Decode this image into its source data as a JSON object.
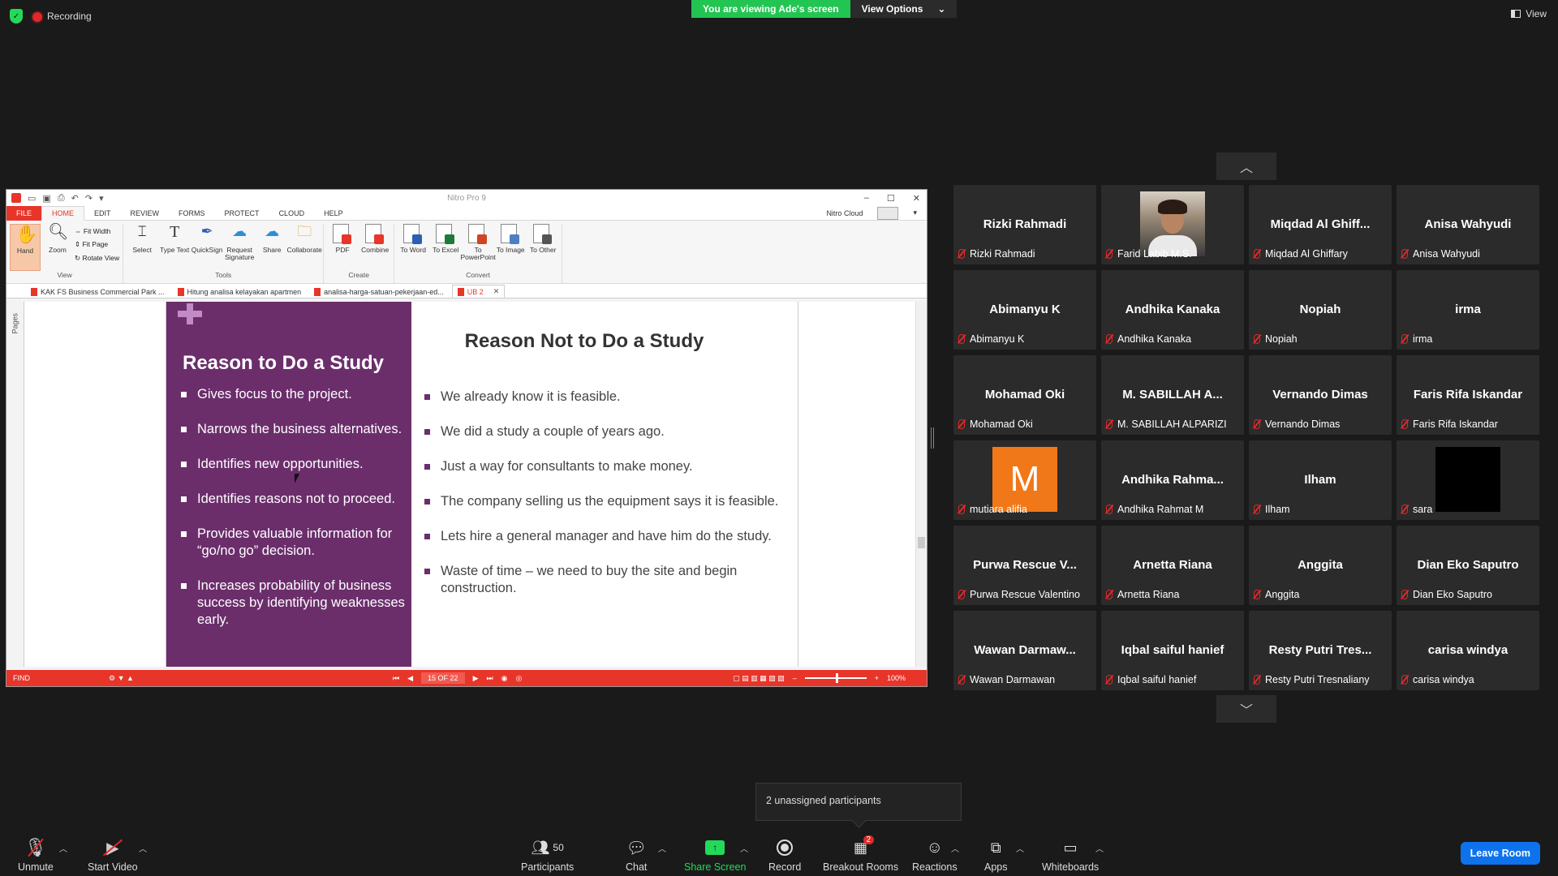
{
  "top": {
    "recording": "Recording",
    "banner": "You are viewing Ade's screen",
    "view_options": "View Options",
    "view": "View"
  },
  "app": {
    "title": "Nitro Pro 9",
    "menu": [
      "FILE",
      "HOME",
      "EDIT",
      "REVIEW",
      "FORMS",
      "PROTECT",
      "CLOUD",
      "HELP"
    ],
    "cloud": "Nitro Cloud",
    "ribbon": {
      "view_group": "View",
      "hand": "Hand",
      "zoom": "Zoom",
      "fit_width": "Fit Width",
      "fit_page": "Fit Page",
      "rotate_view": "Rotate View",
      "tools_group": "Tools",
      "select": "Select",
      "type_text": "Type Text",
      "quicksign": "QuickSign",
      "request_signature": "Request Signature",
      "share": "Share",
      "collaborate": "Collaborate",
      "create_group": "Create",
      "pdf": "PDF",
      "combine": "Combine",
      "convert_group": "Convert",
      "to_word": "To Word",
      "to_excel": "To Excel",
      "to_powerpoint": "To PowerPoint",
      "to_image": "To Image",
      "to_other": "To Other"
    },
    "doc_tabs": [
      "KAK FS Business Commercial Park ...",
      "Hitung analisa kelayakan apartmen",
      "analisa-harga-satuan-pekerjaan-ed...",
      "UB 2"
    ],
    "pages_label": "Pages",
    "status": {
      "find": "FIND",
      "page": "15 OF 22",
      "zoom": "100%"
    }
  },
  "slide": {
    "left_title": "Reason to Do a Study",
    "left_bullets": [
      "Gives focus to the project.",
      "Narrows the business alternatives.",
      "Identifies new opportunities.",
      "Identifies reasons not to proceed.",
      "Provides valuable information for “go/no go” decision.",
      "Increases probability of business success by identifying weaknesses early."
    ],
    "right_title": "Reason Not to Do a Study",
    "right_bullets": [
      "We already know it is feasible.",
      "We did a study a couple of years ago.",
      "Just a way for consultants to make money.",
      "The company selling us the equipment says it is feasible.",
      "Lets hire a general manager and have him do the study.",
      "Waste of time – we need to buy the site and begin construction."
    ]
  },
  "participants": [
    {
      "big": "Rizki Rahmadi",
      "label": "Rizki Rahmadi"
    },
    {
      "big": "",
      "label": "Farid Labib M.S.",
      "kind": "photo"
    },
    {
      "big": "Miqdad Al Ghiff...",
      "label": "Miqdad Al Ghiffary"
    },
    {
      "big": "Anisa Wahyudi",
      "label": "Anisa Wahyudi"
    },
    {
      "big": "Abimanyu K",
      "label": "Abimanyu K"
    },
    {
      "big": "Andhika Kanaka",
      "label": "Andhika Kanaka"
    },
    {
      "big": "Nopiah",
      "label": "Nopiah"
    },
    {
      "big": "irma",
      "label": "irma"
    },
    {
      "big": "Mohamad Oki",
      "label": "Mohamad Oki"
    },
    {
      "big": "M. SABILLAH A...",
      "label": "M. SABILLAH ALPARIZI"
    },
    {
      "big": "Vernando Dimas",
      "label": "Vernando Dimas"
    },
    {
      "big": "Faris Rifa Iskandar",
      "label": "Faris Rifa Iskandar"
    },
    {
      "big": "M",
      "label": "mutiara alifia",
      "kind": "initial"
    },
    {
      "big": "Andhika Rahma...",
      "label": "Andhika Rahmat M"
    },
    {
      "big": "Ilham",
      "label": "Ilham"
    },
    {
      "big": "",
      "label": "sara",
      "kind": "black"
    },
    {
      "big": "Purwa Rescue V...",
      "label": "Purwa Rescue Valentino"
    },
    {
      "big": "Arnetta Riana",
      "label": "Arnetta Riana"
    },
    {
      "big": "Anggita",
      "label": "Anggita"
    },
    {
      "big": "Dian Eko Saputro",
      "label": "Dian Eko Saputro"
    },
    {
      "big": "Wawan Darmaw...",
      "label": "Wawan Darmawan"
    },
    {
      "big": "Iqbal saiful hanief",
      "label": "Iqbal saiful hanief"
    },
    {
      "big": "Resty Putri Tres...",
      "label": "Resty Putri Tresnaliany"
    },
    {
      "big": "carisa windya",
      "label": "carisa windya"
    }
  ],
  "tooltip": "2 unassigned participants",
  "toolbar": {
    "unmute": "Unmute",
    "start_video": "Start Video",
    "participants": "Participants",
    "participants_count": "50",
    "chat": "Chat",
    "share_screen": "Share Screen",
    "record": "Record",
    "breakout_rooms": "Breakout Rooms",
    "breakout_badge": "2",
    "reactions": "Reactions",
    "apps": "Apps",
    "whiteboards": "Whiteboards",
    "leave_room": "Leave Room"
  }
}
